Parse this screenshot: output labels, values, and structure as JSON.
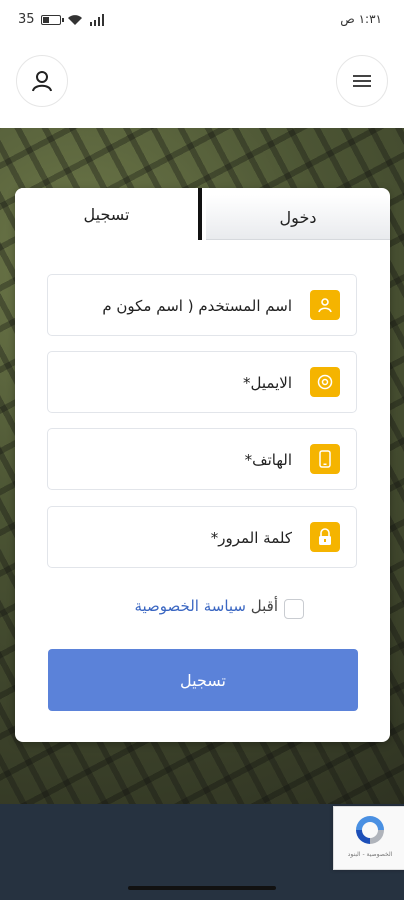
{
  "status": {
    "battery_text": "35",
    "battery_level": 0.35,
    "time": "١:٣١ ص"
  },
  "header": {
    "profile_icon": "user-icon",
    "menu_icon": "hamburger-icon"
  },
  "tabs": {
    "register": "تسجيل",
    "login": "دخول"
  },
  "fields": [
    {
      "label": "اسم المستخدم ( اسم مكون م",
      "icon": "user-icon"
    },
    {
      "label": "الايميل*",
      "icon": "at-icon"
    },
    {
      "label": "الهاتف*",
      "icon": "phone-icon"
    },
    {
      "label": "كلمة المرور*",
      "icon": "lock-icon"
    }
  ],
  "privacy": {
    "prefix": "أقبل ",
    "link": "سياسة الخصوصية"
  },
  "submit_label": "تسجيل",
  "recaptcha": {
    "footer": "الخصوصية - البنود"
  },
  "colors": {
    "accent": "#f5b400",
    "button": "#5b82d9",
    "link": "#3b67c2",
    "footer_band": "#263240"
  }
}
